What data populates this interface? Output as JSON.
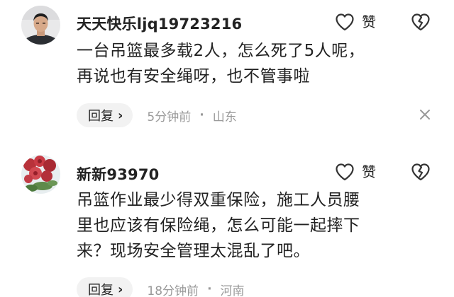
{
  "comments": [
    {
      "username": "天天快乐ljq19723216",
      "like_label": "赞",
      "content": "一台吊篮最多载2人，怎么死了5人呢，\n再说也有安全绳呀，也不管事啦",
      "reply_label": "回复",
      "time": "5分钟前",
      "separator": "·",
      "location": "山东",
      "has_close": true
    },
    {
      "username": "新新93970",
      "like_label": "赞",
      "content": "吊篮作业最少得双重保险，施工人员腰\n里也应该有保险绳，怎么可能一起摔下\n来？现场安全管理太混乱了吧。",
      "reply_label": "回复",
      "time": "18分钟前",
      "separator": "·",
      "location": "河南",
      "has_close": false
    }
  ],
  "icons": {
    "like": "heart-outline-icon",
    "dislike": "broken-heart-icon",
    "reply_chevron": "chevron-right-icon",
    "close": "close-icon"
  },
  "colors": {
    "text_primary": "#222222",
    "text_secondary": "#999999",
    "pill_bg": "#f2f2f2",
    "background": "#ffffff"
  }
}
